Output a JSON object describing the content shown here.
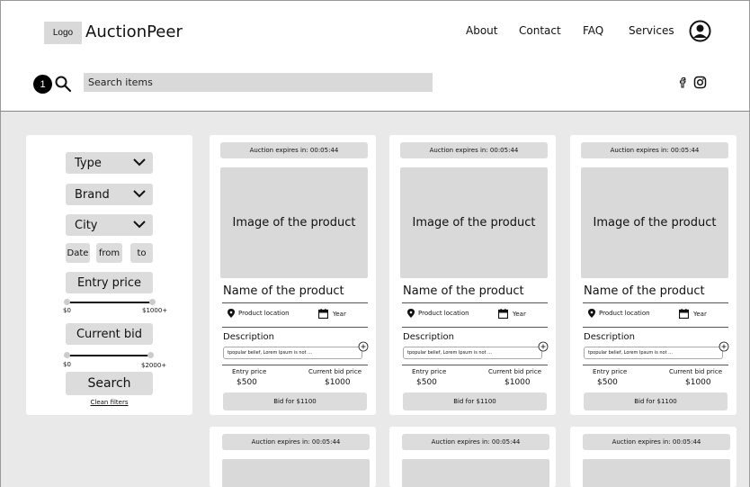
{
  "header": {
    "logo_label": "Logo",
    "brand": "AuctionPeer",
    "nav": [
      "About",
      "Contact",
      "FAQ",
      "Services"
    ],
    "profile_icon": "user-circle-icon"
  },
  "search": {
    "badge": "1",
    "placeholder": "Search items",
    "icon": "search-icon"
  },
  "social": [
    "facebook-icon",
    "instagram-icon"
  ],
  "filters": {
    "type": "Type",
    "brand": "Brand",
    "city": "City",
    "date": "Date",
    "from": "from",
    "to": "to",
    "entry_price": "Entry price",
    "entry_min": "$0",
    "entry_max": "$1000+",
    "current_bid": "Current bid",
    "bid_min": "$0",
    "bid_max": "$2000+",
    "search_button": "Search",
    "clean_filters": "Clean filters"
  },
  "cards": [
    {
      "timer": "Auction expires in:  00:05:44",
      "image": "Image of the product",
      "name": "Name of the product",
      "location": "Product location",
      "year": "Year",
      "description_label": "Description",
      "description": "tpopular belief, Lorem Ipsum is not ...",
      "entry_label": "Entry price",
      "entry_value": "$500",
      "bid_label": "Current bid price",
      "bid_value": "$1000",
      "bid_button": "Bid for $1100"
    },
    {
      "timer": "Auction expires in:  00:05:44",
      "image": "Image of the product",
      "name": "Name of the product",
      "location": "Product location",
      "year": "Year",
      "description_label": "Description",
      "description": "tpopular belief, Lorem Ipsum is not ...",
      "entry_label": "Entry price",
      "entry_value": "$500",
      "bid_label": "Current bid price",
      "bid_value": "$1000",
      "bid_button": "Bid for $1100"
    },
    {
      "timer": "Auction expires in:  00:05:44",
      "image": "Image of the product",
      "name": "Name of the product",
      "location": "Product location",
      "year": "Year",
      "description_label": "Description",
      "description": "tpopular belief, Lorem Ipsum is not ...",
      "entry_label": "Entry price",
      "entry_value": "$500",
      "bid_label": "Current bid price",
      "bid_value": "$1000",
      "bid_button": "Bid for $1100"
    }
  ],
  "partial_cards": [
    {
      "timer": "Auction expires in:  00:05:44"
    },
    {
      "timer": "Auction expires in:  00:05:44"
    },
    {
      "timer": "Auction expires in:  00:05:44"
    }
  ]
}
